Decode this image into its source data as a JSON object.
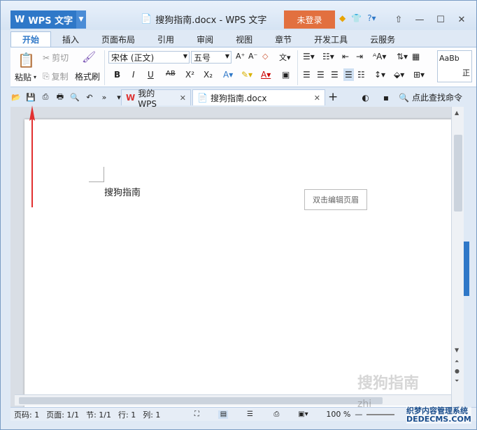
{
  "app": {
    "name": "WPS 文字",
    "logo_letter": "W",
    "window_title": "搜狗指南.docx - WPS 文字",
    "login_label": "未登录"
  },
  "menu": {
    "tabs": [
      "开始",
      "插入",
      "页面布局",
      "引用",
      "审阅",
      "视图",
      "章节",
      "开发工具",
      "云服务"
    ]
  },
  "ribbon": {
    "paste": "粘贴",
    "cut": "剪切",
    "copy": "复制",
    "format_painter": "格式刷",
    "font_name": "宋体 (正文)",
    "font_size": "五号",
    "bold": "B",
    "italic": "I",
    "underline": "U",
    "strikethrough": "AB",
    "superscript": "X²",
    "subscript": "X₂",
    "style_preview": "AaBb",
    "style_name": "正"
  },
  "tabs": {
    "home": "我的WPS",
    "document": "搜狗指南.docx",
    "add": "+"
  },
  "search": {
    "label": "点此查找命令"
  },
  "document": {
    "text": "搜狗指南",
    "header_hint": "双击编辑页眉"
  },
  "status": {
    "page_num": "页码: 1",
    "pages": "页面: 1/1",
    "section": "节: 1/1",
    "row": "行: 1",
    "col": "列: 1",
    "zoom": "100 %"
  },
  "watermark": {
    "text1": "搜狗指南",
    "text2": "zhi",
    "site_name": "织梦内容管理系统",
    "site_url": "DEDECMS.COM"
  },
  "colors": {
    "accent": "#2f78c8",
    "login": "#e2703f",
    "arrow": "#e23030"
  }
}
